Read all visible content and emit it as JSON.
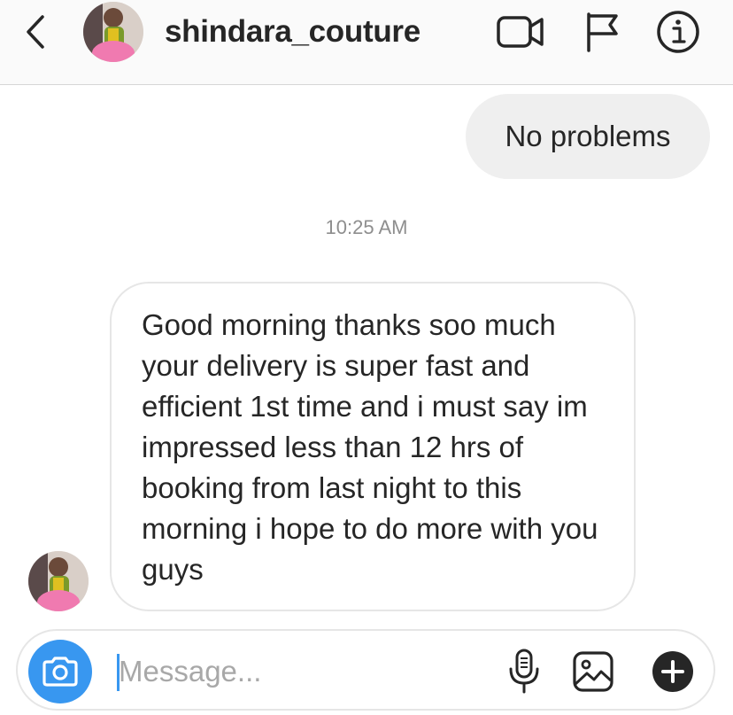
{
  "header": {
    "username": "shindara_couture",
    "icons": {
      "back": "chevron-left-icon",
      "video": "video-camera-icon",
      "flag": "flag-icon",
      "info": "info-icon"
    }
  },
  "conversation": {
    "sent_message": "No problems",
    "timestamp": "10:25 AM",
    "received_message": "Good morning thanks soo much your delivery is super fast and efficient 1st time and i must say im impressed less than 12 hrs of booking from last night to this morning i hope to do more with you guys"
  },
  "composer": {
    "placeholder": "Message...",
    "value": "",
    "icons": {
      "camera": "camera-icon",
      "mic": "microphone-icon",
      "gallery": "image-gallery-icon",
      "plus": "plus-icon"
    }
  },
  "colors": {
    "accent": "#3897f0",
    "sent_bubble": "#efefef",
    "text": "#262626",
    "muted": "#8e8e8e",
    "border": "#e6e6e6"
  }
}
